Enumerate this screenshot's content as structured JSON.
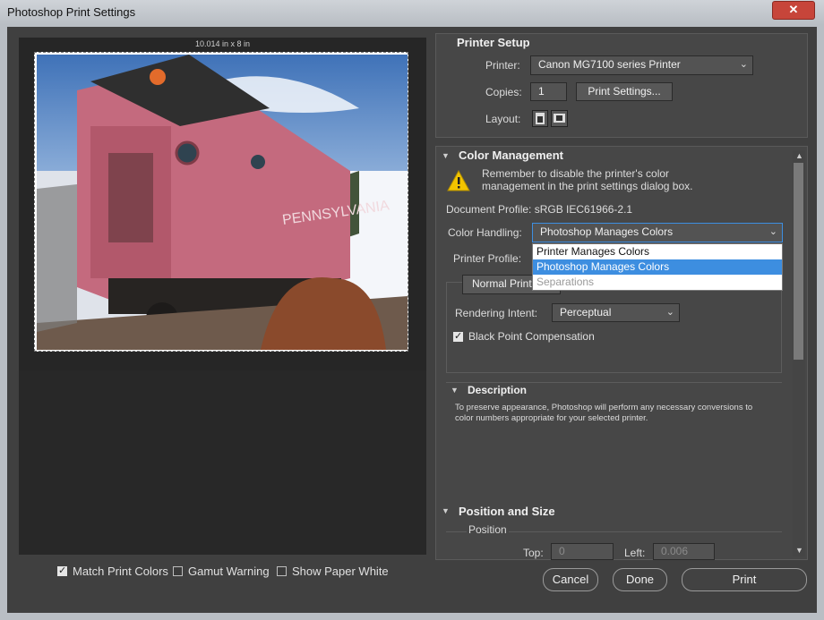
{
  "window": {
    "title": "Photoshop Print Settings",
    "close_glyph": "✕"
  },
  "preview": {
    "size_label": "10.014 in x 8 in"
  },
  "bottom_options": {
    "match_print_colors": {
      "label": "Match Print Colors",
      "checked": true
    },
    "gamut_warning": {
      "label": "Gamut Warning",
      "checked": false
    },
    "show_paper_white": {
      "label": "Show Paper White",
      "checked": false
    }
  },
  "printer_setup": {
    "header": "Printer Setup",
    "printer_label": "Printer:",
    "printer_value": "Canon MG7100 series Printer",
    "copies_label": "Copies:",
    "copies_value": "1",
    "print_settings_button": "Print Settings...",
    "layout_label": "Layout:"
  },
  "color_management": {
    "header": "Color Management",
    "warning_text": "Remember to disable the printer's color management in the print settings dialog box.",
    "document_profile": "Document Profile: sRGB IEC61966-2.1",
    "color_handling_label": "Color Handling:",
    "color_handling_value": "Photoshop Manages Colors",
    "color_handling_options": [
      "Printer Manages Colors",
      "Photoshop Manages Colors",
      "Separations"
    ],
    "selected_option_index": 1,
    "printer_profile_label": "Printer Profile:",
    "normal_printing": "Normal Print",
    "rendering_intent_label": "Rendering Intent:",
    "rendering_intent_value": "Perceptual",
    "black_point_label": "Black Point Compensation",
    "black_point_checked": true
  },
  "description": {
    "header": "Description",
    "text": "To preserve appearance, Photoshop will perform any necessary conversions to color numbers appropriate for your selected printer."
  },
  "position_size": {
    "header": "Position and Size",
    "position_label": "Position",
    "top_label": "Top:",
    "top_value": "0",
    "left_label": "Left:",
    "left_value": "0.006"
  },
  "buttons": {
    "cancel": "Cancel",
    "done": "Done",
    "print": "Print"
  },
  "colors": {
    "accent": "#3d8ee0",
    "warning": "#f2c400",
    "close": "#c7453a"
  }
}
